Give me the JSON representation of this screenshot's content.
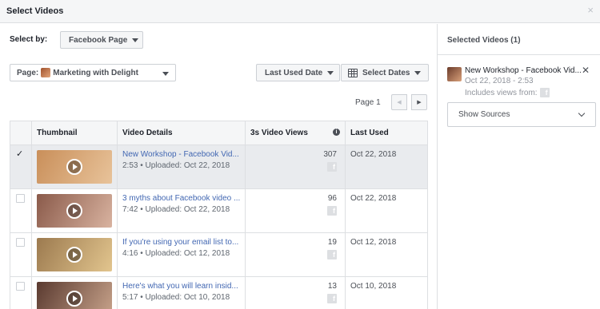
{
  "dialog": {
    "title": "Select Videos",
    "close_glyph": "×"
  },
  "filters": {
    "select_by_label": "Select by:",
    "select_by_value": "Facebook Page",
    "page_prefix": "Page:",
    "page_name": "Marketing with Delight",
    "sort_label": "Last Used Date",
    "dates_label": "Select Dates"
  },
  "pagination": {
    "label": "Page 1"
  },
  "table": {
    "headers": [
      "",
      "Thumbnail",
      "Video Details",
      "3s Video Views",
      "Last Used"
    ],
    "info_glyph": "i",
    "rows": [
      {
        "selected": true,
        "check_glyph": "✓",
        "title": "New Workshop - Facebook Vid...",
        "meta": "2:53 • Uploaded: Oct 22, 2018",
        "views": "307",
        "last_used": "Oct 22, 2018",
        "thumb_colors": [
          "#c98f5a",
          "#e8c39a"
        ]
      },
      {
        "selected": false,
        "title": "3 myths about Facebook video ...",
        "meta": "7:42 • Uploaded: Oct 22, 2018",
        "views": "96",
        "last_used": "Oct 22, 2018",
        "thumb_colors": [
          "#8a5a4a",
          "#d9b3a0"
        ]
      },
      {
        "selected": false,
        "title": "If you're using your email list to...",
        "meta": "4:16 • Uploaded: Oct 12, 2018",
        "views": "19",
        "last_used": "Oct 12, 2018",
        "thumb_colors": [
          "#9c7a4f",
          "#e2c58e"
        ]
      },
      {
        "selected": false,
        "title": "Here's what you will learn insid...",
        "meta": "5:17 • Uploaded: Oct 10, 2018",
        "views": "13",
        "last_used": "Oct 10, 2018",
        "thumb_colors": [
          "#5a3a30",
          "#c7a28a"
        ]
      }
    ]
  },
  "sidebar": {
    "title": "Selected Videos (1)",
    "selected_item": {
      "title": "New Workshop - Facebook Vid...",
      "date": "Oct 22, 2018 - 2:53",
      "includes_label": "Includes views from:",
      "remove_glyph": "✕"
    },
    "show_sources_label": "Show Sources"
  },
  "colors": {
    "link": "#4267b2",
    "selected_row": "#e9ebee",
    "border": "#dddfe2"
  }
}
